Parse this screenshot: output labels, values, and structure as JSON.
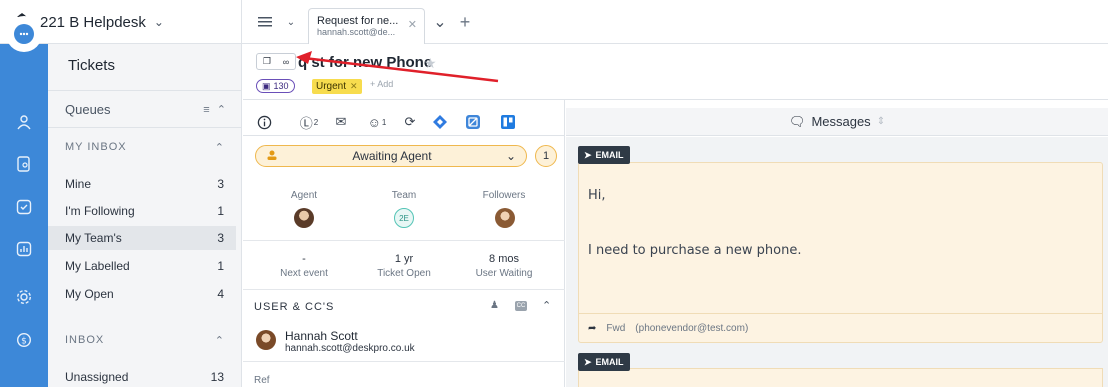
{
  "app": {
    "name": "221 B Helpdesk"
  },
  "tab": {
    "title": "Request for ne...",
    "subtitle": "hannah.scott@de..."
  },
  "sidebar": {
    "title": "Tickets",
    "queues_label": "Queues",
    "my_inbox_label": "MY INBOX",
    "my_inbox": [
      {
        "label": "Mine",
        "count": "3"
      },
      {
        "label": "I'm Following",
        "count": "1"
      },
      {
        "label": "My Team's",
        "count": "3"
      },
      {
        "label": "My Labelled",
        "count": "1"
      },
      {
        "label": "My Open",
        "count": "4"
      }
    ],
    "inbox_label": "INBOX",
    "inbox": [
      {
        "label": "Unassigned",
        "count": "13"
      }
    ]
  },
  "ticket": {
    "title": "q  st for new Phone",
    "count_badge": "130",
    "urgency_label": "Urgent",
    "add_label": "+ Add",
    "tools": {
      "billing_count": "2",
      "users_count": "1"
    },
    "status": "Awaiting Agent",
    "status_count": "1",
    "agent_label": "Agent",
    "team_label": "Team",
    "team_initials": "2E",
    "followers_label": "Followers",
    "next_event_value": "-",
    "next_event_label": "Next event",
    "ticket_open_value": "1 yr",
    "ticket_open_label": "Ticket Open",
    "user_waiting_value": "8 mos",
    "user_waiting_label": "User Waiting",
    "users_heading": "USER & CC'S",
    "user_name": "Hannah Scott",
    "user_email": "hannah.scott@deskpro.co.uk",
    "ref_label": "Ref"
  },
  "messages": {
    "heading": "Messages",
    "items": [
      {
        "type_label": "EMAIL",
        "greeting": "Hi,",
        "body": "I need to purchase a new phone.",
        "footer_action": "Fwd",
        "footer_address": "(phonevendor@test.com)"
      },
      {
        "type_label": "EMAIL"
      }
    ]
  },
  "colors": {
    "rail": "#3d88d8",
    "urgent": "#f7dc4e",
    "status": "#efb84e",
    "arrow": "#e0202a"
  }
}
